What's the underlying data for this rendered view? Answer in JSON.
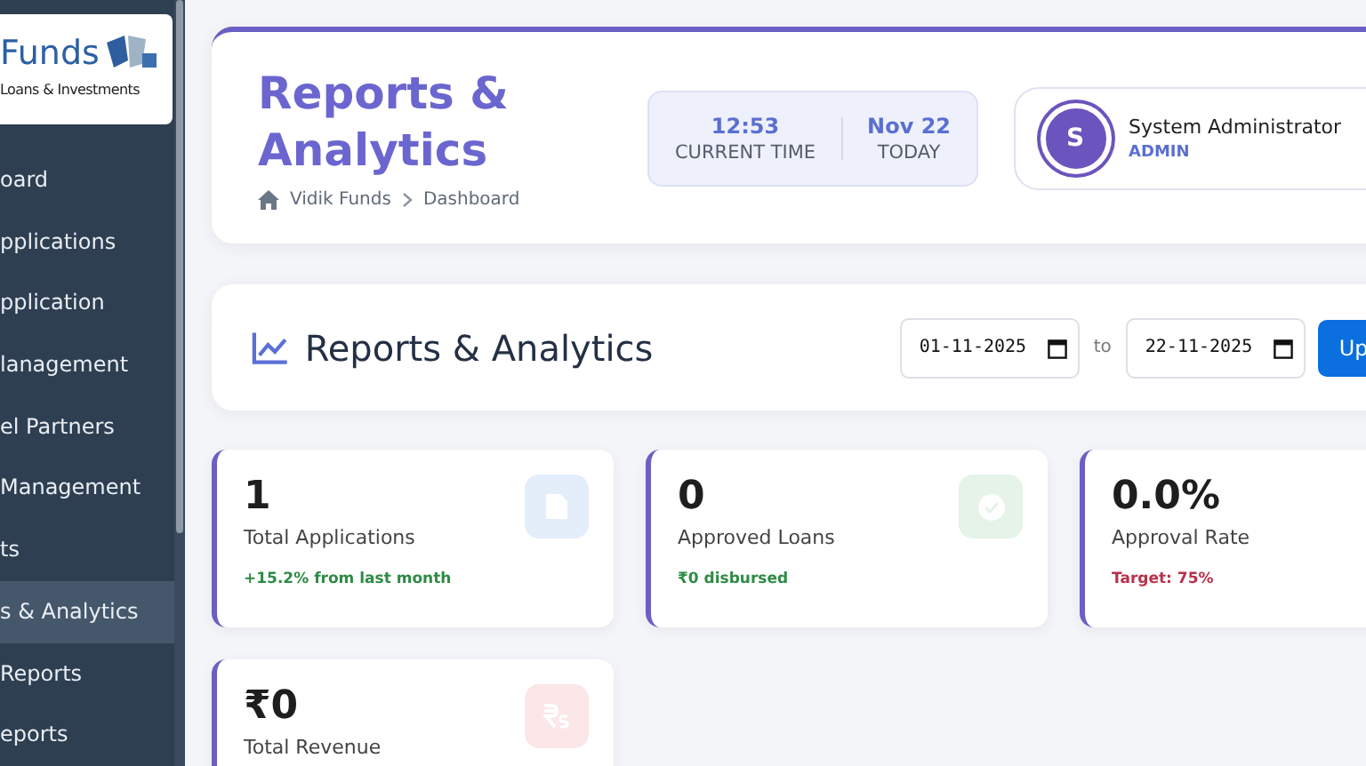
{
  "sidebar": {
    "logo": {
      "name": "Funds",
      "tagline": "Loans & Investments"
    },
    "items": [
      {
        "label": "oard",
        "selected": false
      },
      {
        "label": "pplications",
        "selected": false
      },
      {
        "label": "pplication",
        "selected": false
      },
      {
        "label": "lanagement",
        "selected": false
      },
      {
        "label": "el Partners",
        "selected": false
      },
      {
        "label": "Management",
        "selected": false
      },
      {
        "label": "ts",
        "selected": false
      },
      {
        "label": "s & Analytics",
        "selected": true
      },
      {
        "label": "Reports",
        "selected": false
      },
      {
        "label": "eports",
        "selected": false
      }
    ]
  },
  "header": {
    "title": "Reports & Analytics",
    "breadcrumb": [
      "Vidik Funds",
      "Dashboard"
    ],
    "clock": [
      {
        "value": "12:53",
        "label": "CURRENT TIME"
      },
      {
        "value": "Nov 22",
        "label": "TODAY"
      }
    ],
    "user": {
      "initial": "S",
      "name": "System Administrator",
      "role": "ADMIN"
    }
  },
  "toolbar": {
    "title": "Reports & Analytics",
    "from": "01-11-2025",
    "separator": "to",
    "to": "22-11-2025",
    "button": "Up"
  },
  "stats": [
    {
      "kind": "applications",
      "value": "1",
      "label": "Total Applications",
      "note": "+15.2% from last month",
      "color": "#2e8b45"
    },
    {
      "kind": "approved",
      "value": "0",
      "label": "Approved Loans",
      "note": "₹0 disbursed",
      "color": "#2e8b45"
    },
    {
      "kind": "rate",
      "value": "0.0%",
      "label": "Approval Rate",
      "note": "Target: 75%",
      "color": "#b8314a"
    },
    {
      "kind": "revenue",
      "value": "₹0",
      "label": "Total Revenue"
    }
  ]
}
